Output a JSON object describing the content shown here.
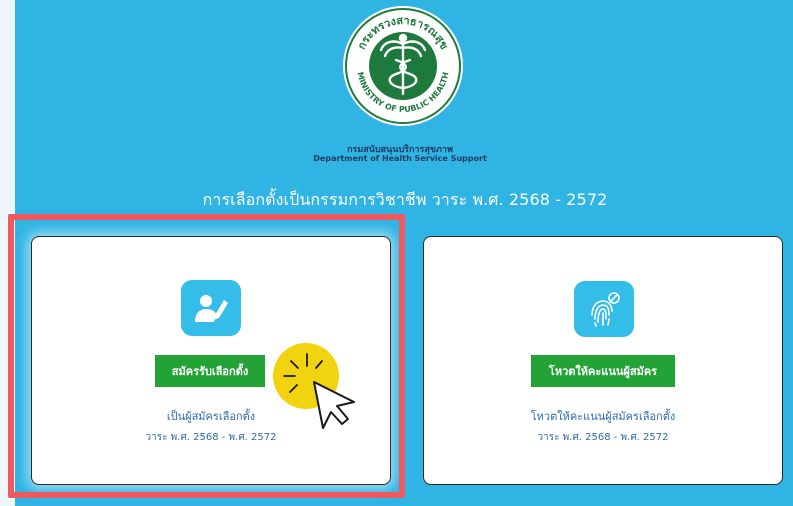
{
  "header": {
    "dept_thai": "กรมสนับสนุนบริการสุขภาพ",
    "dept_english": "Department of Health Service Support",
    "page_title": "การเลือกตั้งเป็นกรรมการวิชาชีพ วาระ พ.ศ. 2568 - 2572",
    "logo": {
      "icon": "ministry-of-public-health-seal",
      "ring_text_top": "กระทรวงสาธารณสุข",
      "ring_text_bottom": "MINISTRY OF PUBLIC HEALTH"
    }
  },
  "cards": {
    "candidate": {
      "icon": "user-edit-icon",
      "button_label": "สมัครรับเลือกตั้ง",
      "description_line1": "เป็นผู้สมัครเลือกตั้ง",
      "description_line2": "วาระ พ.ศ. 2568 - พ.ศ. 2572",
      "highlighted": true
    },
    "vote": {
      "icon": "fingerprint-icon",
      "button_label": "โหวตให้คะแนนผู้สมัคร",
      "description_line1": "โหวตให้คะแนนผู้สมัครเลือกตั้ง",
      "description_line2": "วาระ พ.ศ. 2568 - พ.ศ. 2572"
    }
  },
  "colors": {
    "background": "#2fb4e4",
    "button_green": "#23a336",
    "highlight_red": "#f0585e",
    "text_blue": "#2c6cb3",
    "seal_green": "#1d7a3c",
    "cursor_yellow": "#f2d30f"
  }
}
